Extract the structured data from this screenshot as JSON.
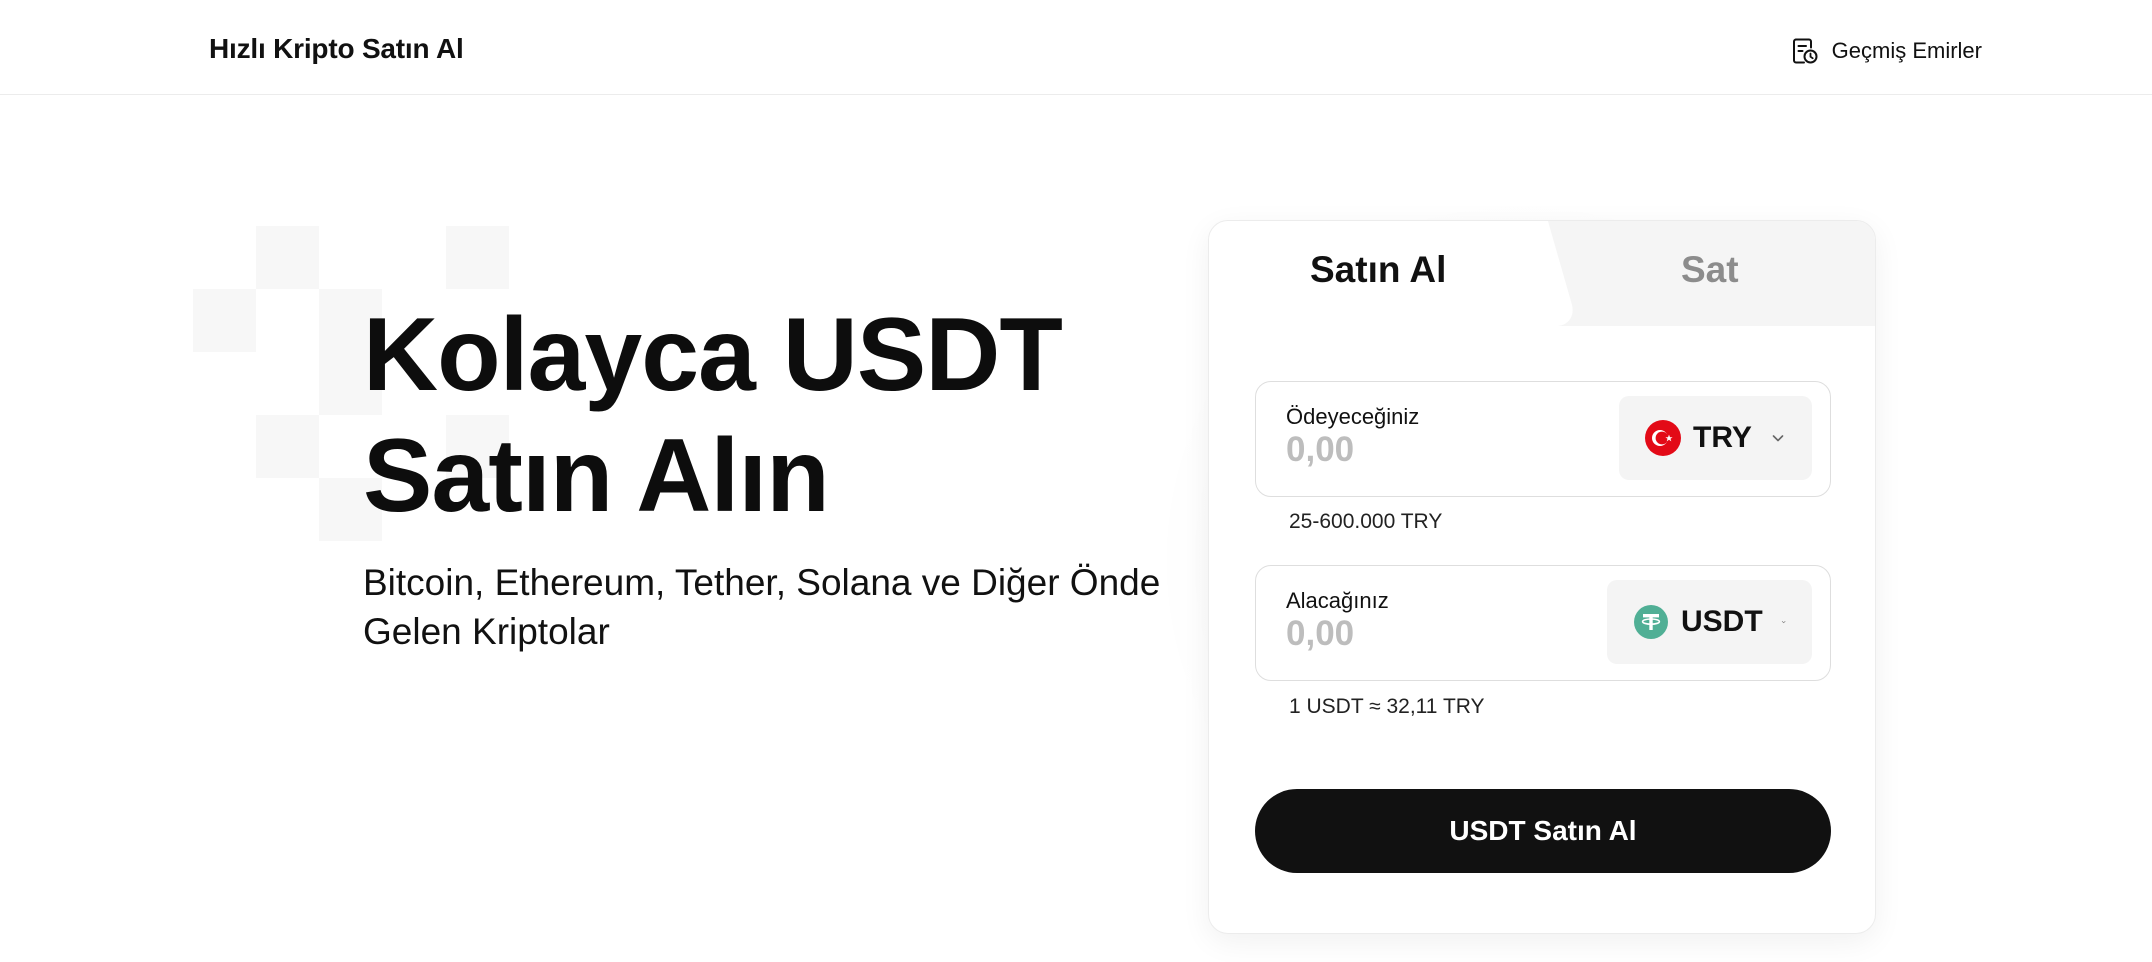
{
  "header": {
    "brand": "Hızlı Kripto Satın Al",
    "history_label": "Geçmiş Emirler",
    "history_icon": "order-history-icon"
  },
  "hero": {
    "title_line1": "Kolayca USDT",
    "title_line2": "Satın Alın",
    "subtitle_line1": "Bitcoin, Ethereum, Tether, Solana ve Diğer Önde",
    "subtitle_line2": "Gelen Kriptolar"
  },
  "card": {
    "tabs": [
      {
        "label": "Satın Al",
        "active": true
      },
      {
        "label": "Sat",
        "active": false
      }
    ],
    "pay": {
      "label": "Ödeyeceğiniz",
      "placeholder": "0,00",
      "currency": "TRY",
      "icon": "turkey-flag-icon",
      "limit": "25-600.000 TRY"
    },
    "receive": {
      "label": "Alacağınız",
      "placeholder": "0,00",
      "currency": "USDT",
      "icon": "tether-icon",
      "rate": "1 USDT ≈ 32,11 TRY"
    },
    "submit_label": "USDT Satın Al"
  },
  "colors": {
    "primary": "#111111",
    "placeholder": "#bdbdbd",
    "try_red": "#e30a17",
    "tether_green": "#50af95",
    "inactive_tab": "#8c8c8c"
  }
}
